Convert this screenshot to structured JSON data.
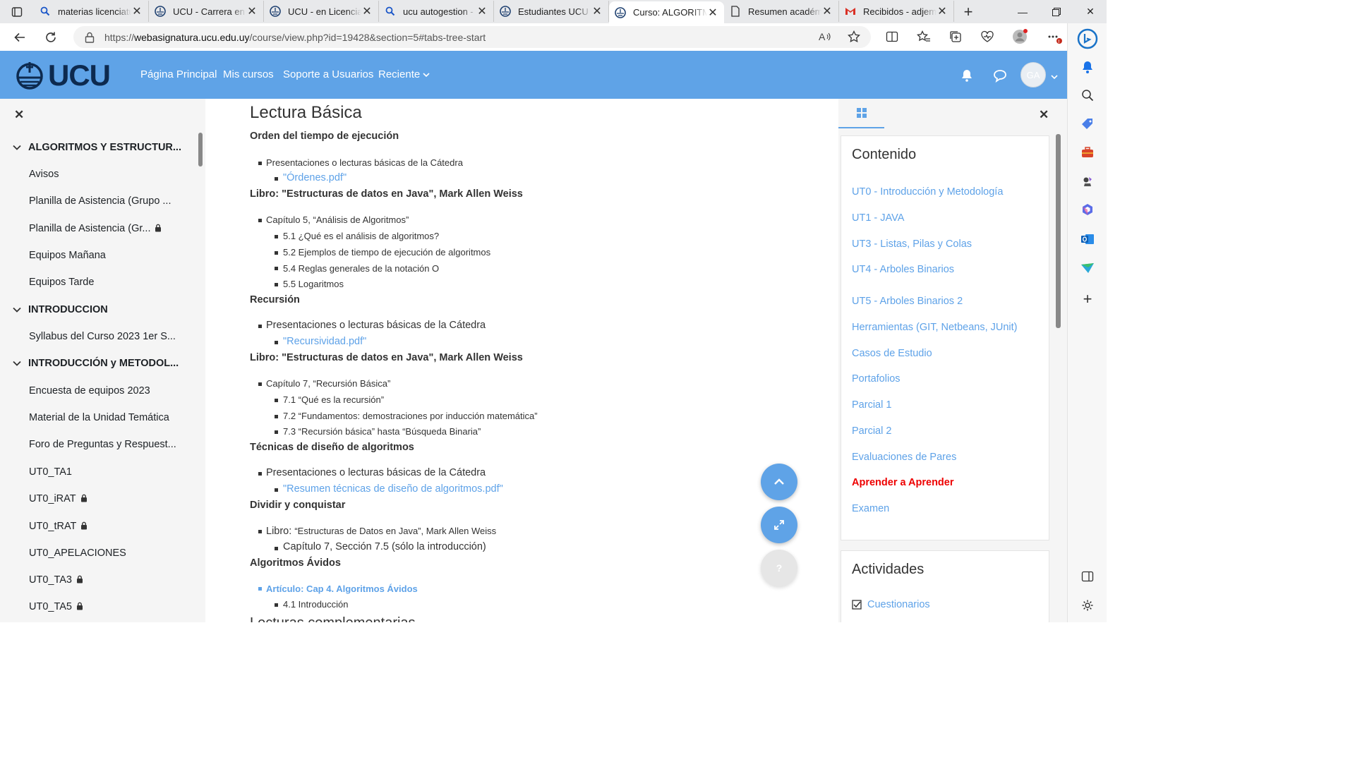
{
  "browser": {
    "tabs": [
      {
        "title": "materias licenciatu",
        "icon": "search-icon"
      },
      {
        "title": "UCU - Carrera en I",
        "icon": "ucu-favicon"
      },
      {
        "title": "UCU - en Licencia",
        "icon": "ucu-favicon"
      },
      {
        "title": "ucu autogestion -",
        "icon": "search-icon"
      },
      {
        "title": "Estudiantes UCU |",
        "icon": "ucu-favicon"
      },
      {
        "title": "Curso: ALGORITM",
        "icon": "ucu-favicon",
        "active": true
      },
      {
        "title": "Resumen académ",
        "icon": "document-icon"
      },
      {
        "title": "Recibidos - adjem",
        "icon": "gmail-icon"
      }
    ],
    "url_prefix": "https://",
    "url_host": "webasignatura.ucu.edu.uy",
    "url_path": "/course/view.php?id=19428&section=5#tabs-tree-start"
  },
  "moodle": {
    "logo_text": "UCU",
    "nav": [
      "Página Principal",
      "Mis cursos",
      "Soporte a Usuarios",
      "Reciente"
    ],
    "avatar_initials": "GA",
    "brand_color": "#5fa3e7"
  },
  "left_drawer": {
    "items": [
      {
        "type": "section",
        "label": "ALGORITMOS Y ESTRUCTUR..."
      },
      {
        "type": "item",
        "label": "Avisos"
      },
      {
        "type": "item",
        "label": "Planilla de Asistencia (Grupo ..."
      },
      {
        "type": "item",
        "label": "Planilla de Asistencia (Gr...",
        "locked": true
      },
      {
        "type": "item",
        "label": "Equipos Mañana"
      },
      {
        "type": "item",
        "label": "Equipos Tarde"
      },
      {
        "type": "section",
        "label": "INTRODUCCION"
      },
      {
        "type": "item",
        "label": "Syllabus del Curso 2023 1er S..."
      },
      {
        "type": "section",
        "label": "INTRODUCCIÓN y METODOL..."
      },
      {
        "type": "item",
        "label": "Encuesta de equipos 2023"
      },
      {
        "type": "item",
        "label": "Material de la Unidad Temática"
      },
      {
        "type": "item",
        "label": "Foro de Preguntas y Respuest..."
      },
      {
        "type": "item",
        "label": "UT0_TA1"
      },
      {
        "type": "item",
        "label": "UT0_iRAT",
        "locked": true
      },
      {
        "type": "item",
        "label": "UT0_tRAT",
        "locked": true
      },
      {
        "type": "item",
        "label": "UT0_APELACIONES"
      },
      {
        "type": "item",
        "label": "UT0_TA3",
        "locked": true
      },
      {
        "type": "item",
        "label": "UT0_TA5",
        "locked": true
      }
    ]
  },
  "main": {
    "heading": "Lectura Básica",
    "s1_title": "Orden del tiempo de ejecución",
    "s1_l1": "Presentaciones o lecturas básicas de la Cátedra",
    "s1_l2": "\"Órdenes.pdf\"",
    "libro1_prefix": "Libro",
    "libro1_rest": ": \"Estructuras de datos en Java\", Mark Allen Weiss",
    "c5": "Capítulo 5, “Análisis de Algoritmos”",
    "c5_1": "5.1 ¿Qué es el análisis de algoritmos?",
    "c5_2": "5.2 Ejemplos de tiempo de ejecución de algoritmos",
    "c5_4": "5.4 Reglas generales de la notación O",
    "c5_5": "5.5 Logaritmos",
    "s2_title": "Recursión",
    "s2_l1": "Presentaciones o lecturas básicas de la Cátedra",
    "s2_l2": "\"Recursividad.pdf\"",
    "libro2": "Libro: \"Estructuras de datos en Java\", Mark Allen Weiss",
    "c7": "Capítulo 7, “Recursión Básica”",
    "c7_1": "7.1 “Qué es la recursión”",
    "c7_2": "7.2 “Fundamentos: demostraciones por inducción matemática”",
    "c7_3": "7.3 “Recursión básica” hasta “Búsqueda Binaria”",
    "s3_title": "Técnicas de diseño de algoritmos",
    "s3_l1": "Presentaciones o lecturas básicas de la Cátedra",
    "s3_l2": "\"Resumen técnicas de diseño de algoritmos.pdf\"",
    "s4_title": "Dividir y conquistar",
    "s4_l1a": "Libro: ",
    "s4_l1b": "“Estructuras de Datos en Java”, Mark Allen Weiss",
    "s4_l2": "Capítulo 7, Sección  7.5  (sólo la introducción)",
    "s5_title": "Algoritmos Ávidos",
    "s5_l1": "Artículo: Cap 4. Algoritmos Ávidos",
    "s5_l2": "4.1 Introducción",
    "s6_partial": "Lecturas complementarias"
  },
  "right_drawer": {
    "contenido_title": "Contenido",
    "toc": [
      "UT0 - Introducción y Metodología",
      "UT1 - JAVA",
      "UT3 - Listas, Pilas y Colas",
      "UT4 - Arboles Binarios",
      "UT5 - Arboles Binarios 2",
      "Herramientas (GIT, Netbeans, JUnit)",
      "Casos de Estudio",
      "Portafolios",
      "Parcial 1",
      "Parcial 2",
      "Evaluaciones de Pares",
      "Aprender a Aprender",
      "Examen"
    ],
    "highlight_index": 11,
    "actividades_title": "Actividades",
    "actividades_item": "Cuestionarios"
  }
}
